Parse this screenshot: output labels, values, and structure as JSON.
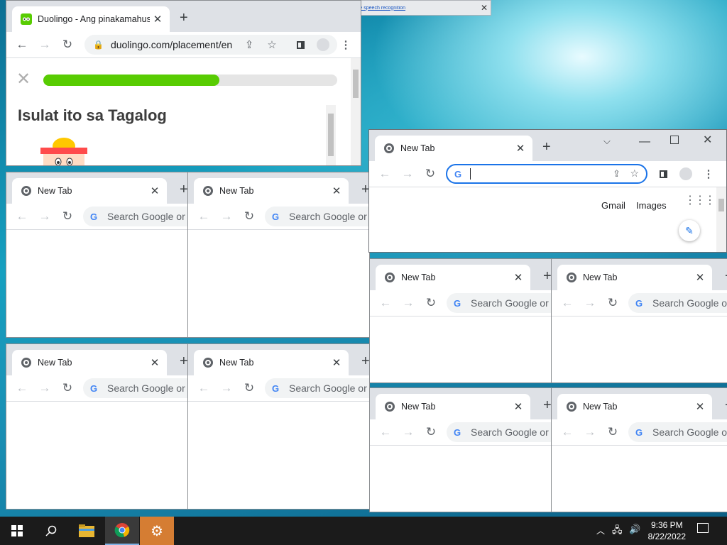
{
  "dictation_bar": {
    "text": "To use dictation, go to Settings and turn on online speech recognition",
    "mic_icon": "microphone-icon"
  },
  "duolingo": {
    "tab_title": "Duolingo - Ang pinakamahusa",
    "url": "duolingo.com/placement/en",
    "progress_fraction": 0.6,
    "prompt": "Isulat ito sa Tagalog",
    "colors": {
      "progress": "#58cc02",
      "brand": "#58cc02"
    }
  },
  "active_window": {
    "tab_title": "New Tab",
    "links": [
      "Gmail",
      "Images"
    ],
    "window_controls": [
      "chevron-down-icon",
      "minimize-icon",
      "maximize-icon",
      "close-icon"
    ]
  },
  "new_tab": {
    "tab_title": "New Tab",
    "omnibox_placeholder": "Search Google or type a URL"
  },
  "taskbar": {
    "time": "9:36 PM",
    "date": "8/22/2022",
    "apps": [
      "windows-start-icon",
      "search-icon",
      "file-explorer-icon",
      "chrome-icon",
      "settings-gear-icon"
    ]
  }
}
